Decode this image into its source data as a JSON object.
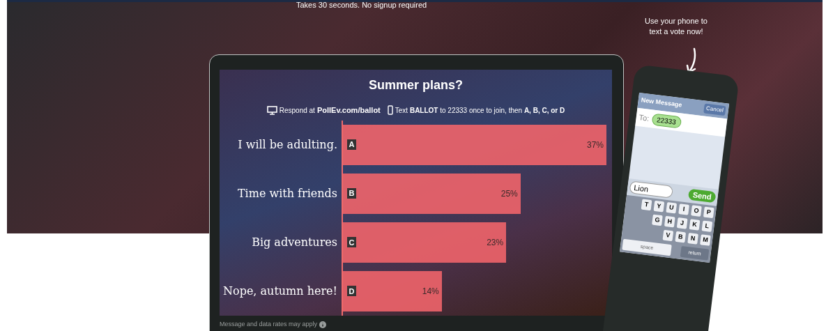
{
  "hero": {
    "tagline": "Takes 30 seconds. No signup required",
    "phone_hint": "Use your phone to text a vote now!"
  },
  "poll": {
    "title": "Summer plans?",
    "respond_prefix": "Respond at",
    "respond_url": "PollEv.com/ballot",
    "text_instructions": "Text **BALLOT** to 22333 once to join, then **A, B, C, or D**",
    "option_keys": [
      "A",
      "B",
      "C",
      "D"
    ],
    "chart_data": {
      "type": "bar",
      "orientation": "horizontal",
      "categories": [
        "I will be adulting.",
        "Time with friends",
        "Big adventures",
        "Nope, autumn here!"
      ],
      "values": [
        37,
        25,
        23,
        14
      ],
      "value_labels": [
        "37%",
        "25%",
        "23%",
        "14%"
      ]
    },
    "footer": "Message and data rates may apply"
  },
  "phone": {
    "header": "New Message",
    "cancel": "Cancel",
    "to_label": "To:",
    "recipient": "22333",
    "message": "Lion",
    "send": "Send",
    "keyboard_rows": [
      [
        "T",
        "Y",
        "U",
        "I",
        "O",
        "P"
      ],
      [
        "G",
        "H",
        "J",
        "K",
        "L"
      ],
      [
        "V",
        "B",
        "N",
        "M"
      ]
    ],
    "space": "space",
    "return": "return"
  }
}
